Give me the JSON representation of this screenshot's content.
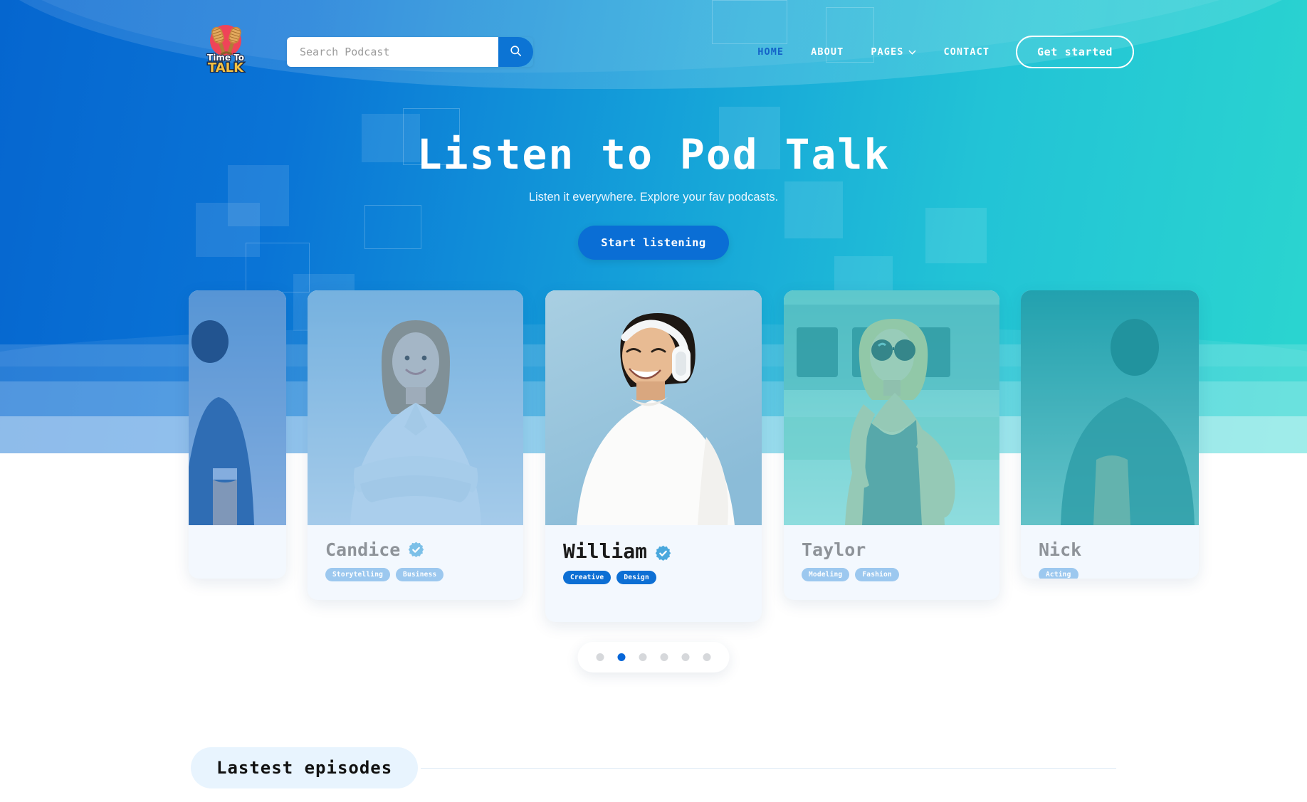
{
  "brand": {
    "logo_line1": "Time To",
    "logo_line2": "TALK",
    "logo_alt": "time-to-talk-logo"
  },
  "search": {
    "placeholder": "Search Podcast",
    "value": "",
    "icon": "search-icon"
  },
  "nav": {
    "items": [
      {
        "label": "HOME",
        "active": true
      },
      {
        "label": "ABOUT",
        "active": false
      },
      {
        "label": "PAGES",
        "active": false,
        "icon": "chevron-down-icon"
      },
      {
        "label": "CONTACT",
        "active": false
      }
    ],
    "cta": "Get started"
  },
  "hero": {
    "title": "Listen to Pod Talk",
    "subtitle": "Listen it everywhere. Explore your fav podcasts.",
    "cta": "Start listening"
  },
  "carousel": {
    "cards": [
      {
        "id": "left",
        "name": "",
        "verified": false,
        "tags": [],
        "active": false
      },
      {
        "id": "candice",
        "name": "Candice",
        "verified": true,
        "tags": [
          "Storytelling",
          "Business"
        ],
        "active": false
      },
      {
        "id": "center",
        "name": "William",
        "verified": true,
        "tags": [
          "Creative",
          "Design"
        ],
        "active": true
      },
      {
        "id": "taylor",
        "name": "Taylor",
        "verified": false,
        "tags": [
          "Modeling",
          "Fashion"
        ],
        "active": false
      },
      {
        "id": "nick",
        "name": "Nick",
        "verified": false,
        "tags": [
          "Acting"
        ],
        "active": false
      }
    ],
    "dots": {
      "count": 6,
      "active_index": 1
    }
  },
  "sections": {
    "latest_episodes": "Lastest episodes"
  },
  "colors": {
    "accent_blue": "#0a6ed5",
    "tag_blue": "#0d6fd4",
    "tag_muted": "#9cc8ef",
    "dot_active": "#0666d8",
    "gradient_start": "#0566cf",
    "gradient_end": "#2bd6cf",
    "card_bg": "#f3f8fe",
    "pill_bg": "#e8f4fe"
  }
}
